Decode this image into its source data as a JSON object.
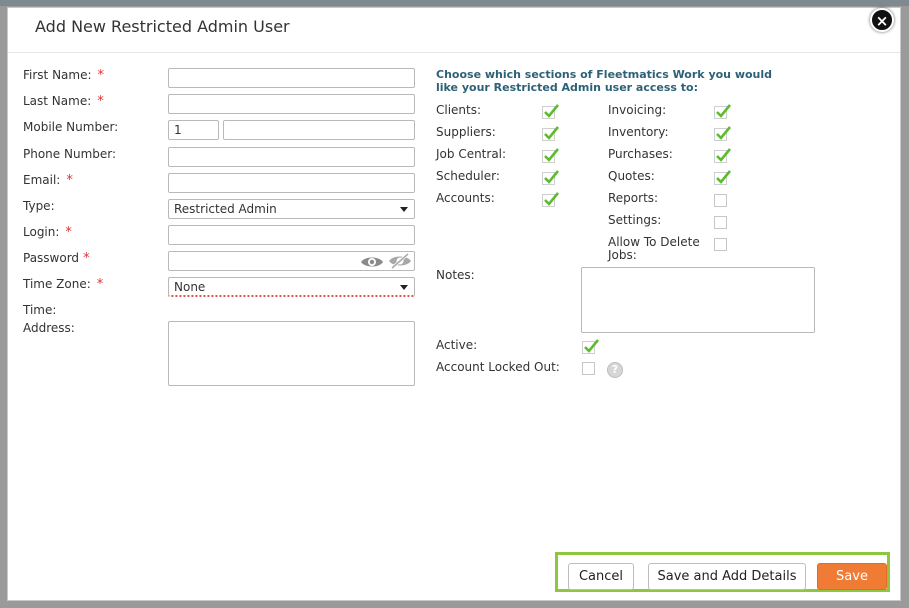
{
  "modal": {
    "title": "Add New Restricted Admin User",
    "close_glyph": "×"
  },
  "form": {
    "first_name": {
      "label": "First Name:",
      "value": ""
    },
    "last_name": {
      "label": "Last Name:",
      "value": ""
    },
    "mobile_number": {
      "label": "Mobile Number:",
      "country_code": "1",
      "value": ""
    },
    "phone_number": {
      "label": "Phone Number:",
      "value": ""
    },
    "email": {
      "label": "Email:",
      "value": ""
    },
    "type": {
      "label": "Type:",
      "selected": "Restricted Admin"
    },
    "login": {
      "label": "Login:",
      "value": ""
    },
    "password": {
      "label": "Password",
      "value": ""
    },
    "time_zone": {
      "label": "Time Zone:",
      "selected": "None"
    },
    "time_label": "Time:",
    "address": {
      "label": "Address:",
      "value": ""
    },
    "required_marker": "*"
  },
  "access": {
    "heading": "Choose which sections of Fleetmatics Work you would like your Restricted Admin user access to:",
    "left": [
      {
        "label": "Clients:",
        "checked": true
      },
      {
        "label": "Suppliers:",
        "checked": true
      },
      {
        "label": "Job Central:",
        "checked": true
      },
      {
        "label": "Scheduler:",
        "checked": true
      },
      {
        "label": "Accounts:",
        "checked": true
      }
    ],
    "right": [
      {
        "label": "Invoicing:",
        "checked": true
      },
      {
        "label": "Inventory:",
        "checked": true
      },
      {
        "label": "Purchases:",
        "checked": true
      },
      {
        "label": "Quotes:",
        "checked": true
      },
      {
        "label": "Reports:",
        "checked": false
      },
      {
        "label": "Settings:",
        "checked": false
      },
      {
        "label": "Allow To Delete Jobs:",
        "checked": false
      }
    ]
  },
  "notes": {
    "label": "Notes:",
    "value": ""
  },
  "status": {
    "active": {
      "label": "Active:",
      "checked": true
    },
    "locked": {
      "label": "Account Locked Out:",
      "checked": false
    },
    "help_glyph": "?"
  },
  "footer": {
    "cancel": "Cancel",
    "save_add_details": "Save and Add Details",
    "save": "Save"
  },
  "colors": {
    "accent_orange": "#f07b35",
    "highlight_green": "#8ec63f",
    "heading_blue": "#2d6177",
    "required_red": "#e0312f",
    "check_green": "#5dbb2e"
  }
}
